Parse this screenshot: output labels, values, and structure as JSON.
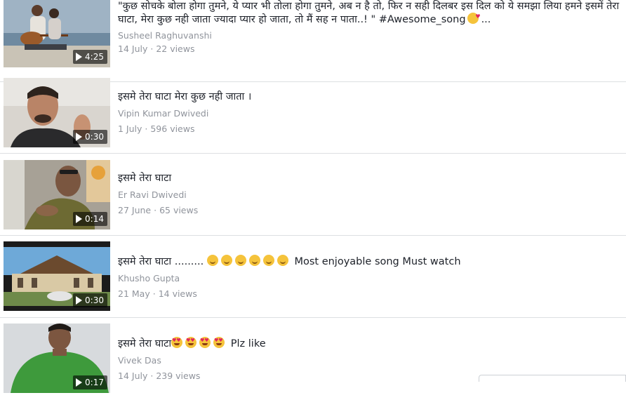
{
  "videos": [
    {
      "title": "\"कुछ सोचके बोला होगा तुमने, ये प्यार भी तोला होगा तुमने, अब न है तो, फिर न सही दिलबर इस दिल को ये समझा लिया हमने इसमें तेरा घाटा, मेरा कुछ नही जाता ज्यादा प्यार हो जाता, तो मैं सह न पाता..! \" #Awesome_song",
      "title_emoji": "kiss",
      "title_ellipsis": "...",
      "author": "Susheel Raghuvanshi",
      "date": "14 July",
      "views": "22 views",
      "duration": "4:25",
      "thumb": "guitar-beach"
    },
    {
      "title": "इसमे तेरा घाटा मेरा कुछ नही जाता ।",
      "author": "Vipin Kumar Dwivedi",
      "date": "1 July",
      "views": "596 views",
      "duration": "0:30",
      "thumb": "selfie-man"
    },
    {
      "title": "इसमे तेरा घाटा",
      "author": "Er Ravi Dwivedi",
      "date": "27 June",
      "views": "65 views",
      "duration": "0:14",
      "thumb": "room-man"
    },
    {
      "title": "इसमे तेरा घाटा .........",
      "title_suffix": "Most enjoyable song Must watch",
      "emoji_count": 6,
      "author": "Khusho Gupta",
      "date": "21 May",
      "views": "14 views",
      "duration": "0:30",
      "thumb": "building"
    },
    {
      "title": "इसमे तेरा घाटा",
      "title_suffix": "Plz like",
      "emoji_count": 4,
      "author": "Vivek Das",
      "date": "14 July",
      "views": "239 views",
      "duration": "0:17",
      "thumb": "green-shirt"
    }
  ],
  "separator": "·",
  "colors": {
    "meta": "#90949c",
    "divider": "#dddfe2",
    "text": "#1d2129"
  }
}
